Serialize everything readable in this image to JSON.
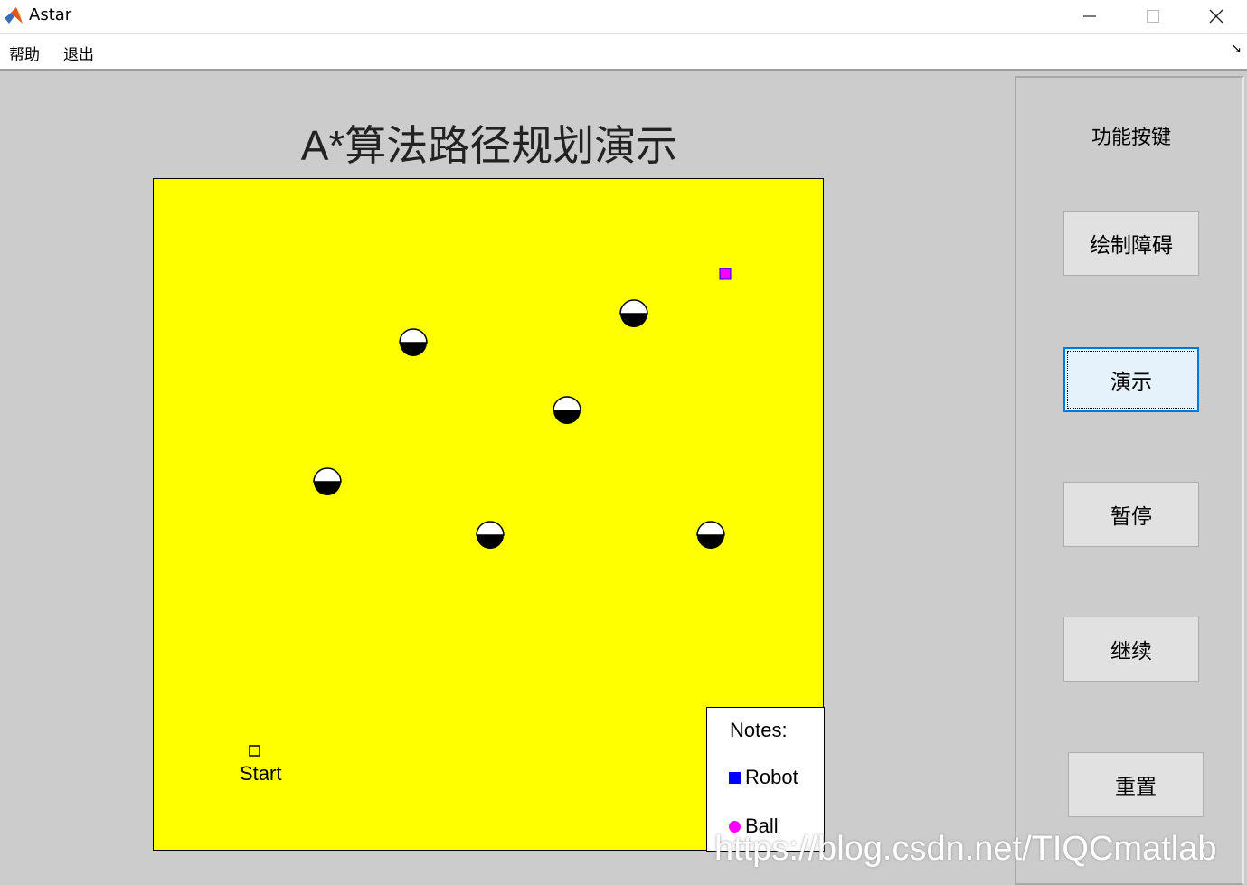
{
  "window": {
    "title": "Astar",
    "icon": "matlab-logo-icon",
    "controls": [
      "minimize-icon",
      "maximize-icon",
      "close-icon"
    ]
  },
  "menu": {
    "help_label": "帮助",
    "exit_label": "退出",
    "toolbar_toggle": "↘"
  },
  "plot": {
    "title": "A*算法路径规划演示",
    "background_color": "#ffff00",
    "start_label": "Start",
    "legend": {
      "title": "Notes:",
      "robot_label": "Robot",
      "ball_label": "Ball",
      "robot_color": "#0000ff",
      "ball_color": "#ff00ff"
    }
  },
  "panel": {
    "title": "功能按键",
    "buttons": {
      "draw_obstacle": "绘制障碍",
      "demo": "演示",
      "pause": "暂停",
      "continue": "继续",
      "reset": "重置"
    }
  },
  "watermark": "https://blog.csdn.net/TIQCmatlab"
}
